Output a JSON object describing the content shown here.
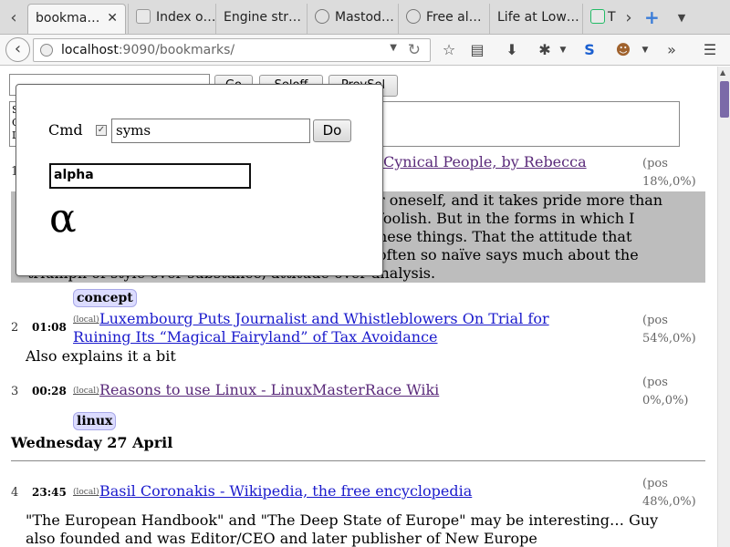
{
  "tabs": [
    {
      "title": "bookma…",
      "active": true
    },
    {
      "title": "Index o…"
    },
    {
      "title": "Engine str…"
    },
    {
      "title": "Mastod…"
    },
    {
      "title": "Free al…"
    },
    {
      "title": "Life at Low…"
    },
    {
      "title": "T"
    }
  ],
  "url": {
    "host": "localhost",
    "path": ":9090/bookmarks/"
  },
  "page_form": {
    "go_label": "Go",
    "sel_off_label": "Seloff",
    "prevsel_label": "PrevSel",
    "textarea_lines": [
      "S",
      "C",
      "L"
    ]
  },
  "dialog": {
    "cmd_label": "Cmd",
    "cmd_checked": true,
    "cmd_value": "syms",
    "do_label": "Do",
    "sym_query": "alpha",
    "sym_result": "α"
  },
  "bookmarks": [
    {
      "num": "1",
      "title": "Cynical People, by Rebecca",
      "pos": [
        "(pos",
        "18%,0%)"
      ],
      "quote_lines": [
        "r oneself, and it takes pride more than",
        " foolish. But in the forms in which I",
        "hese things. That the attitude that",
        "often so naïve says much about the",
        "triumph of style over substance, attitude over analysis."
      ],
      "tags": [
        "concept"
      ]
    },
    {
      "num": "2",
      "time": "01:08",
      "local": "(local)",
      "title_lines": [
        "Luxembourg Puts Journalist and Whistleblowers On Trial for",
        "Ruining Its “Magical Fairyland” of Tax Avoidance"
      ],
      "pos": [
        "(pos",
        "54%,0%)"
      ],
      "note": "Also explains it a bit"
    },
    {
      "num": "3",
      "time": "00:28",
      "local": "(local)",
      "title": "Reasons to use Linux - LinuxMasterRace Wiki",
      "pos": [
        "(pos",
        "0%,0%)"
      ],
      "tags": [
        "linux"
      ]
    },
    {
      "num": "4",
      "time": "23:45",
      "local": "(local)",
      "title": "Basil Coronakis - Wikipedia, the free encyclopedia",
      "pos": [
        "(pos",
        "48%,0%)"
      ],
      "note_lines": [
        "\"The European Handbook\" and \"The Deep State of Europe\" may be interesting… Guy",
        "also founded and was Editor/CEO and later publisher of New Europe"
      ]
    }
  ],
  "day_heading": "Wednesday 27 April",
  "icons": [
    "back-icon",
    "globe-icon",
    "reload-icon",
    "bookmark-star-icon",
    "reading-list-icon",
    "download-icon",
    "addon-icon",
    "s-icon",
    "monkey-icon",
    "overflow-icon",
    "menu-icon"
  ]
}
